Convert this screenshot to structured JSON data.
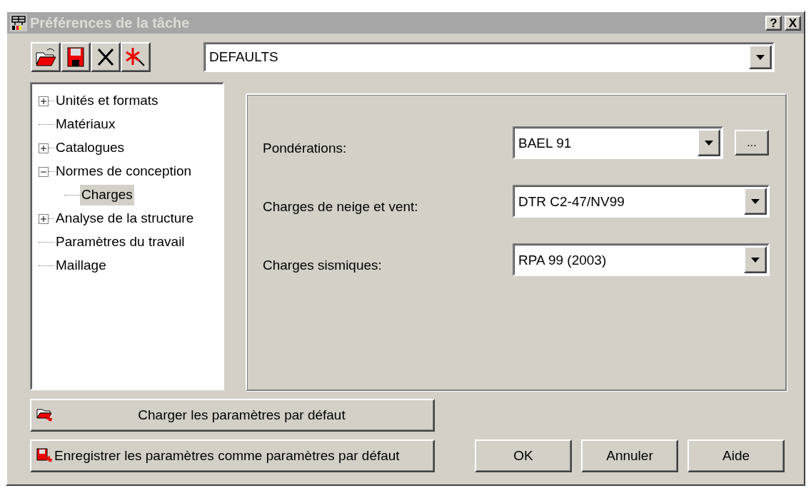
{
  "window": {
    "title": "Préférences de la tâche",
    "buttons": [
      "?",
      "X"
    ]
  },
  "toolbar": [
    {
      "kind": "open"
    },
    {
      "kind": "save"
    },
    {
      "kind": "delete"
    },
    {
      "kind": "new"
    }
  ],
  "preset": {
    "value": "DEFAULTS"
  },
  "tree": [
    {
      "label": "Unités et formats",
      "expanded": false,
      "selected": false
    },
    {
      "label": "Matériaux",
      "selected": false
    },
    {
      "label": "Catalogues",
      "expanded": false,
      "selected": false
    },
    {
      "label": "Normes de conception",
      "expanded": true,
      "selected": false,
      "children": [
        {
          "label": "Charges",
          "selected": true
        }
      ]
    },
    {
      "label": "Analyse de la structure",
      "expanded": false,
      "selected": false
    },
    {
      "label": "Paramètres du travail",
      "selected": false
    },
    {
      "label": "Maillage",
      "selected": false
    }
  ],
  "settings": [
    {
      "label": "Pondérations:",
      "value": "BAEL 91",
      "extra_button": "..."
    },
    {
      "label": "Charges de neige et vent:",
      "value": "DTR C2-47/NV99"
    },
    {
      "label": "Charges sismiques:",
      "value": "RPA 99 (2003)"
    }
  ],
  "default_buttons": [
    {
      "kind": "load",
      "label": "Charger les paramètres par défaut"
    },
    {
      "kind": "save",
      "label": "Enregistrer les paramètres comme paramètres par défaut"
    }
  ],
  "dialog_buttons": [
    "OK",
    "Annuler",
    "Aide"
  ]
}
